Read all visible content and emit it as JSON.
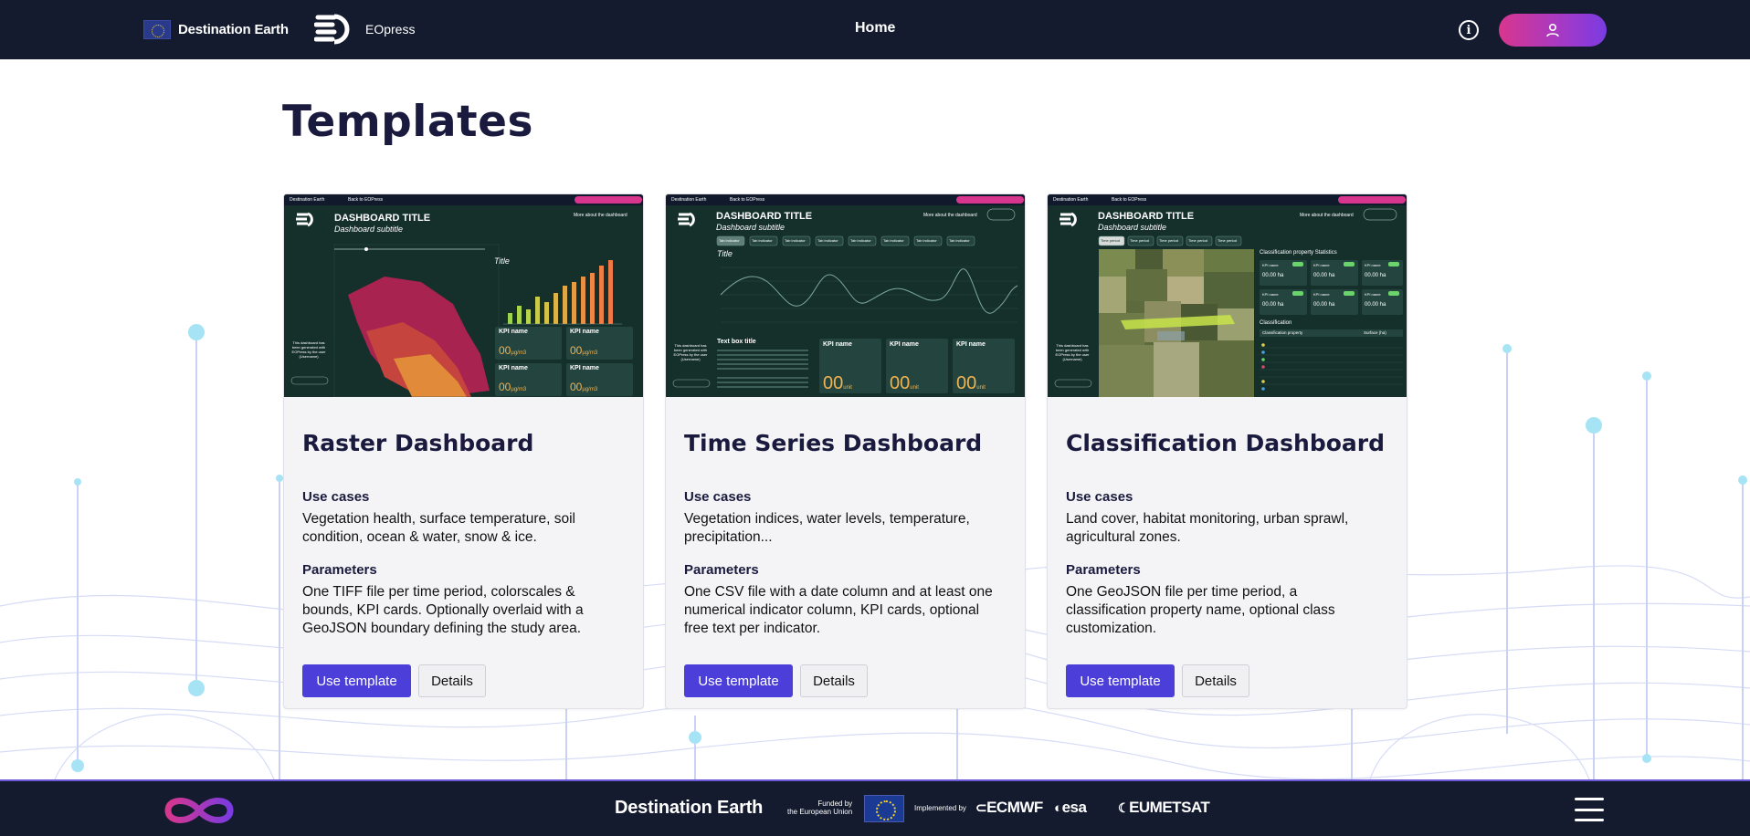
{
  "header": {
    "brand_name": "Destination Earth",
    "eo_brand": "EOpress",
    "nav_home": "Home",
    "info_glyph": "i",
    "user_icon": "user-icon",
    "accent_gradient": [
      "#d8368e",
      "#7a3be0"
    ]
  },
  "page": {
    "title": "Templates"
  },
  "labels": {
    "use_cases": "Use cases",
    "parameters": "Parameters",
    "use_template": "Use template",
    "details": "Details"
  },
  "cards": [
    {
      "title": "Raster Dashboard",
      "use_cases": "Vegetation health, surface temperature, soil condition, ocean & water, snow & ice.",
      "parameters": "One TIFF file per time period, colorscales & bounds, KPI cards. Optionally overlaid with a GeoJSON boundary defining the study area.",
      "thumb": {
        "brand": "Destination Earth",
        "back": "Back to EOPress",
        "dash_title": "DASHBOARD TITLE",
        "dash_subtitle": "Dashboard subtitle",
        "more": "More about the dashboard",
        "chart_title": "Title",
        "kpi_name": "KPI name",
        "kpi_value": "00",
        "kpi_unit": "µg/m3",
        "side_note": "This dashboard has been generated with EOPress by the user (Username)"
      }
    },
    {
      "title": "Time Series Dashboard",
      "use_cases": "Vegetation indices, water levels, temperature, precipitation...",
      "parameters": "One CSV file with a date column and at least one numerical indicator column, KPI cards, optional free text per indicator.",
      "thumb": {
        "brand": "Destination Earth",
        "back": "Back to EOPress",
        "dash_title": "DASHBOARD TITLE",
        "dash_subtitle": "Dashboard subtitle",
        "more": "More about the dashboard",
        "chart_title": "Title",
        "tab": "Tab indicator",
        "text_box": "Text box title",
        "kpi_name": "KPI name",
        "kpi_value": "00",
        "kpi_unit": "unit",
        "side_note": "This dashboard has been generated with EOPress by the user (Username)"
      }
    },
    {
      "title": "Classification Dashboard",
      "use_cases": "Land cover, habitat monitoring, urban sprawl, agricultural zones.",
      "parameters": "One GeoJSON file per time period, a classification property name, optional class customization.",
      "thumb": {
        "brand": "Destination Earth",
        "back": "Back to EOPress",
        "dash_title": "DASHBOARD TITLE",
        "dash_subtitle": "Dashboard subtitle",
        "more": "More about the dashboard",
        "tab": "Time period",
        "stats_title": "Classification property Statistics",
        "class_title": "Classification",
        "class_header": "Classification property",
        "surface_header": "Surface (ha)",
        "kpi_name": "KPI name",
        "kpi_value": "00.00 ha",
        "side_note": "This dashboard has been generated with EOPress by the user (Username)"
      }
    }
  ],
  "footer": {
    "brand_name": "Destination Earth",
    "funded_line1": "Funded by",
    "funded_line2": "the European Union",
    "implemented": "Implemented by",
    "partners": [
      "ECMWF",
      "esa",
      "EUMETSAT"
    ],
    "menu_icon": "hamburger-menu-icon",
    "logo_icon": "infinity-logo-icon"
  }
}
